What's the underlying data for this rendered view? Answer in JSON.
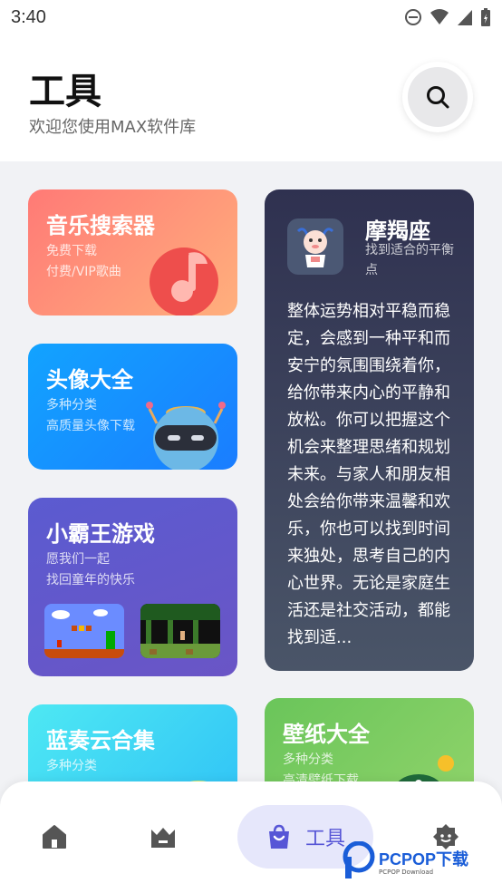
{
  "status_bar": {
    "time": "3:40"
  },
  "header": {
    "title": "工具",
    "subtitle": "欢迎您使用MAX软件库"
  },
  "cards": {
    "music": {
      "title": "音乐搜索器",
      "line1": "免费下载",
      "line2": "付费/VIP歌曲"
    },
    "avatar": {
      "title": "头像大全",
      "line1": "多种分类",
      "line2": "高质量头像下载"
    },
    "game": {
      "title": "小霸王游戏",
      "line1": "愿我们一起",
      "line2": "找回童年的快乐"
    },
    "lanzou": {
      "title": "蓝奏云合集",
      "line1": "多种分类"
    },
    "horoscope": {
      "title": "摩羯座",
      "subtitle": "找到适合的平衡点",
      "body": "整体运势相对平稳而稳定，会感到一种平和而安宁的氛围围绕着你，给你带来内心的平静和放松。你可以把握这个机会来整理思绪和规划未来。与家人和朋友相处会给你带来温馨和欢乐，你也可以找到时间来独处，思考自己的内心世界。无论是家庭生活还是社交活动，都能找到适..."
    },
    "wallpaper": {
      "title": "壁纸大全",
      "line1": "多种分类",
      "line2": "高清壁纸下载"
    }
  },
  "tabbar": {
    "items": [
      {
        "icon": "home-icon"
      },
      {
        "icon": "gamepad-icon"
      },
      {
        "icon": "shopping-bag-icon",
        "label": "工具",
        "active": true
      },
      {
        "icon": "settings-icon"
      }
    ]
  },
  "watermark": {
    "brand": "PCPOP下载",
    "small": "PCPOP Download"
  },
  "colors": {
    "accent": "#5756d6",
    "tab_active_bg": "#e6e7fb"
  }
}
